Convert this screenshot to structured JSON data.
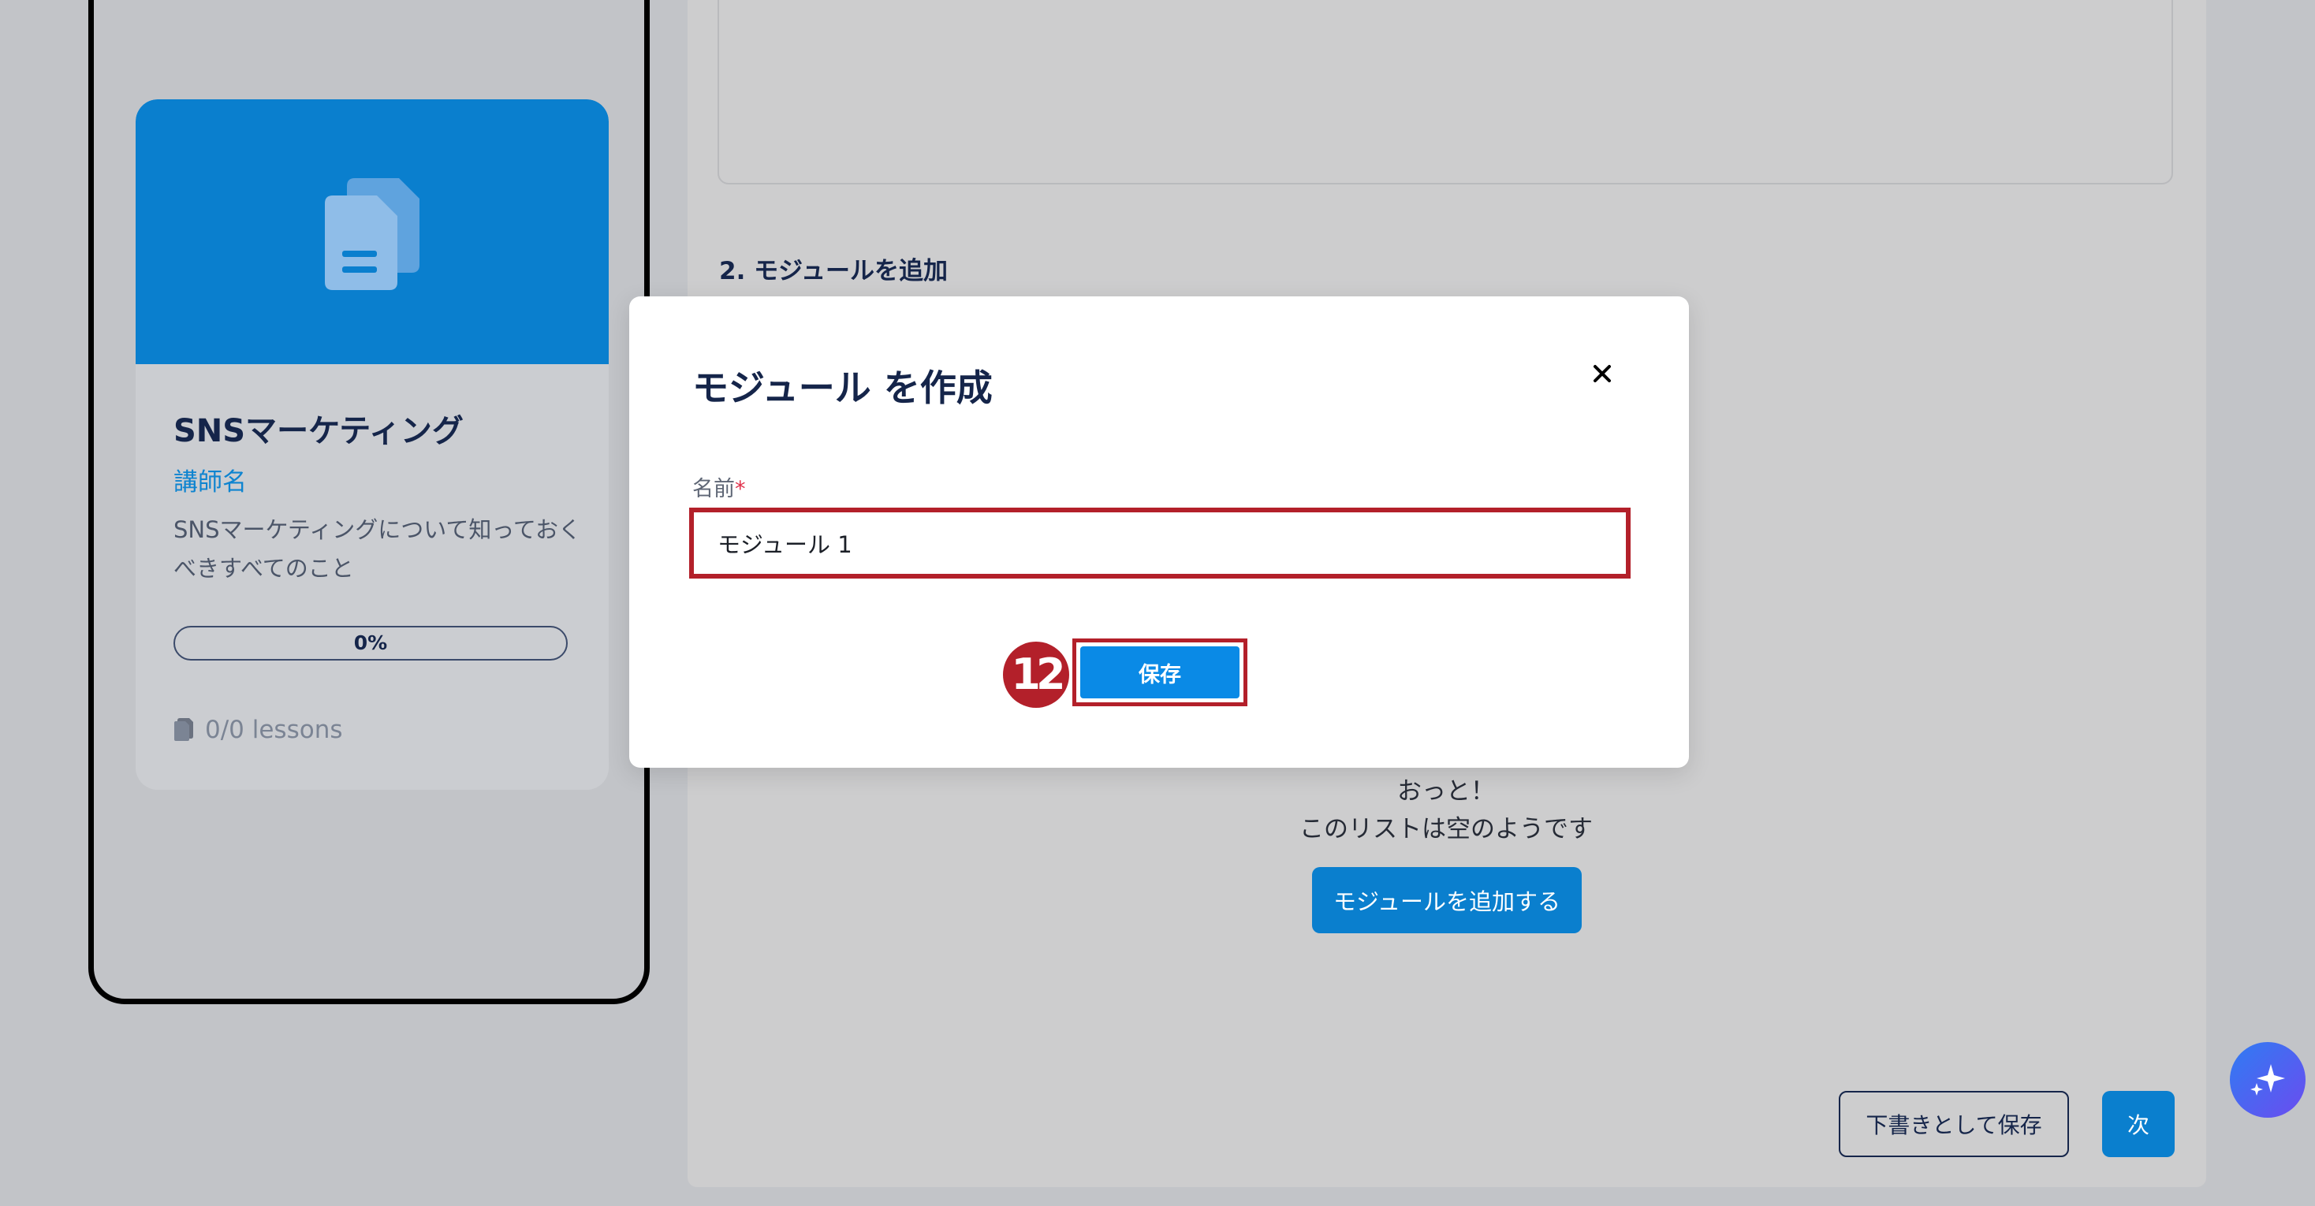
{
  "preview": {
    "course_title": "SNSマーケティング",
    "instructor": "講師名",
    "description": "SNSマーケティングについて知っておくべきすべてのこと",
    "progress": "0%",
    "progress_value": 0,
    "lessons": "0/0 lessons"
  },
  "editor": {
    "section_title": "2. モジュールを追加",
    "empty_line1": "おっと！",
    "empty_line2": "このリストは空のようです",
    "add_module_button": "モジュールを追加する",
    "save_draft_button": "下書きとして保存",
    "next_button": "次"
  },
  "modal": {
    "title": "モジュール を作成",
    "name_label": "名前",
    "required_mark": "*",
    "name_value": "モジュール 1",
    "save_button": "保存",
    "step_number": "12"
  },
  "colors": {
    "primary": "#0a7fce",
    "highlight": "#b3202a",
    "navy": "#15254a"
  },
  "icons": {
    "hero": "documents-icon",
    "lessons": "document-icon",
    "close": "close-icon",
    "ai": "sparkle-icon"
  }
}
